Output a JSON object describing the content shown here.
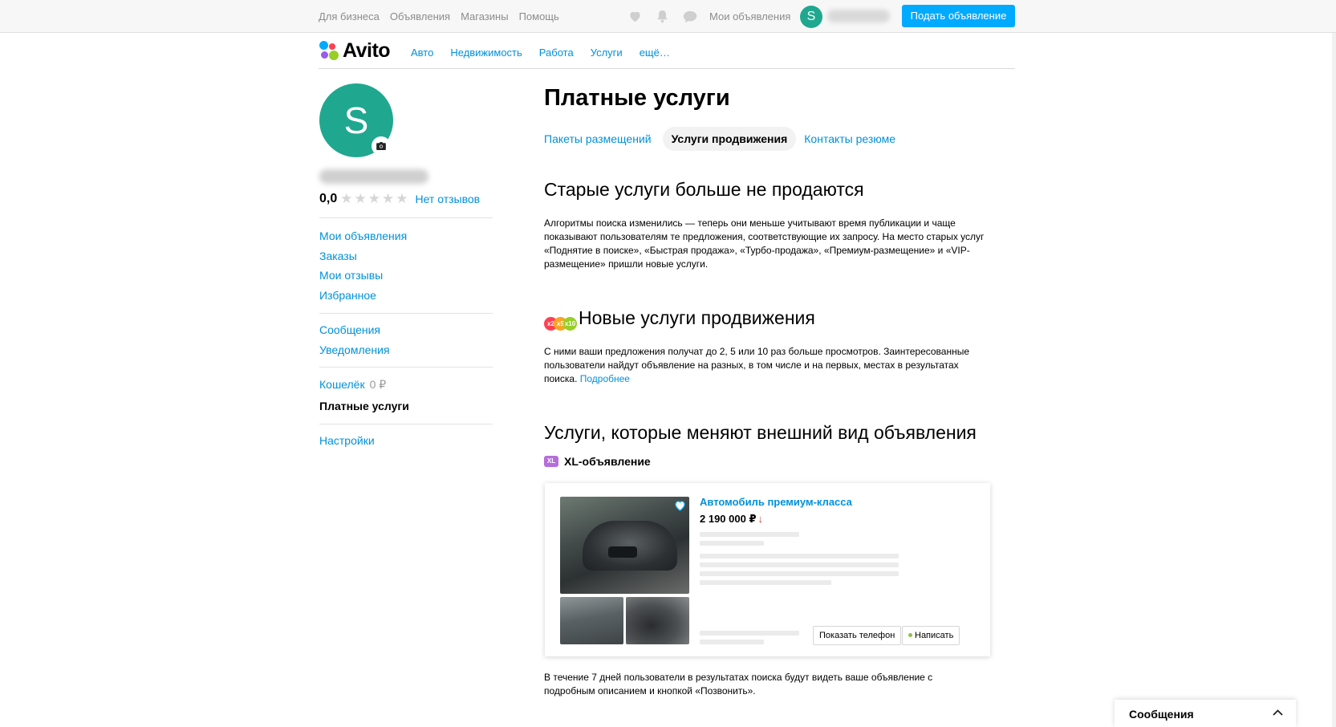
{
  "topbar": {
    "links": [
      "Для бизнеса",
      "Объявления",
      "Магазины",
      "Помощь"
    ],
    "icons": [
      "heart-icon",
      "bell-icon",
      "chat-icon"
    ],
    "my_ads": "Мои объявления",
    "avatar_letter": "S",
    "post_button": "Подать объявление"
  },
  "header": {
    "logo_text": "Avito",
    "categories": [
      "Авто",
      "Недвижимость",
      "Работа",
      "Услуги",
      "ещё…"
    ]
  },
  "profile": {
    "avatar_letter": "S",
    "rating": "0,0",
    "stars": [
      "★",
      "★",
      "★",
      "★",
      "★"
    ],
    "reviews": "Нет отзывов"
  },
  "sidebar": {
    "group1": [
      "Мои объявления",
      "Заказы",
      "Мои отзывы",
      "Избранное"
    ],
    "group2": [
      "Сообщения",
      "Уведомления"
    ],
    "wallet_label": "Кошелёк",
    "wallet_value": "0 ₽",
    "paid_services": "Платные услуги",
    "settings": "Настройки"
  },
  "main": {
    "title": "Платные услуги",
    "tabs": [
      "Пакеты размещений",
      "Услуги продвижения",
      "Контакты резюме"
    ],
    "section1": {
      "heading": "Старые услуги больше не продаются",
      "text": "Алгоритмы поиска изменились — теперь они меньше учитывают время публикации и чаще показывают пользователям те предложения, соответствующие их запросу. На место старых услуг «Поднятие в поиске», «Быстрая продажа», «Турбо-продажа», «Премиум-размещение» и «VIP-размещение» пришли новые услуги."
    },
    "section2": {
      "badges": [
        "x2",
        "x5",
        "x10"
      ],
      "heading": "Новые услуги продвижения",
      "text": "С ними ваши предложения получат до 2, 5 или 10 раз больше просмотров. Заинтересованные пользователи найдут объявление на разных, в том числе и на первых, местах в результатах поиска.",
      "link": "Подробнее"
    },
    "section3": {
      "heading": "Услуги, которые меняют внешний вид объявления",
      "xl_badge": "XL",
      "xl_title": "XL-объявление",
      "card": {
        "title": "Автомобиль премиум-класса",
        "price": "2 190 000 ₽",
        "price_arrow": "↓",
        "btn_phone": "Показать телефон",
        "btn_write": "Написать"
      },
      "text": "В течение 7 дней пользователи в результатах поиска будут видеть ваше объявление с подробным описанием и кнопкой «Позвонить»."
    }
  },
  "messages_widget": {
    "title": "Сообщения"
  },
  "colors": {
    "accent": "#0091d9",
    "button": "#00aaff",
    "avatar": "#1fa88f"
  }
}
